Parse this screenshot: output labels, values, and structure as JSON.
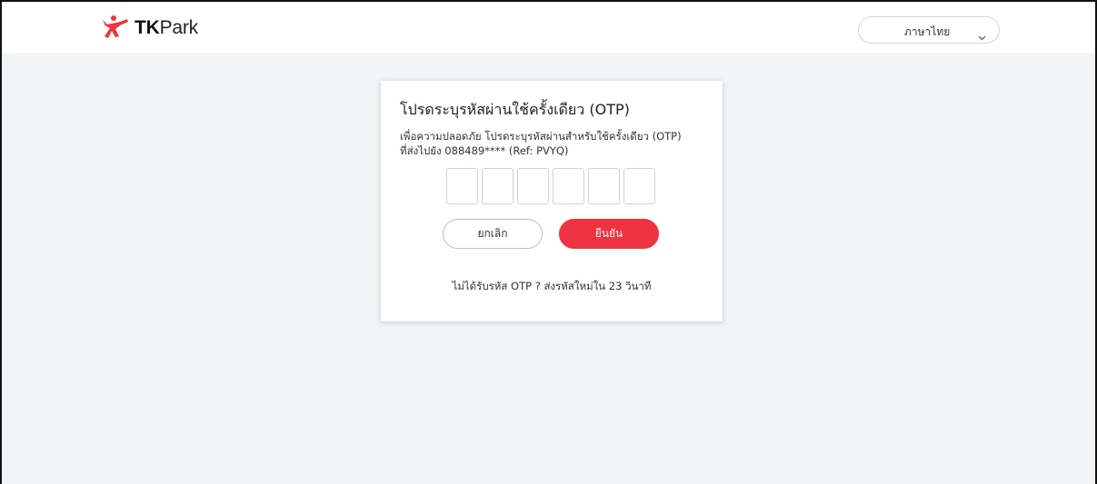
{
  "header": {
    "logo_text_bold": "TK",
    "logo_text": "Park",
    "language": {
      "selected": "ภาษาไทย",
      "icon": "chevron-down-icon"
    }
  },
  "otp_dialog": {
    "title": "โปรดระบุรหัสผ่านใช้ครั้งเดียว (OTP)",
    "description_line1": "เพื่อความปลอดภัย โปรดระบุรหัสผ่านสำหรับใช้ครั้งเดียว (OTP)",
    "description_line2": "ที่ส่งไปยัง 088489****  (Ref: PVYQ)",
    "otp_digits": [
      "",
      "",
      "",
      "",
      "",
      ""
    ],
    "cancel_label": "ยกเลิก",
    "confirm_label": "ยืนยัน",
    "resend_text": "ไม่ได้รับรหัส OTP ? ส่งรหัสใหม่ใน 23 วินาที"
  },
  "colors": {
    "brand_red": "#ef3340",
    "background": "#f2f5f8"
  }
}
